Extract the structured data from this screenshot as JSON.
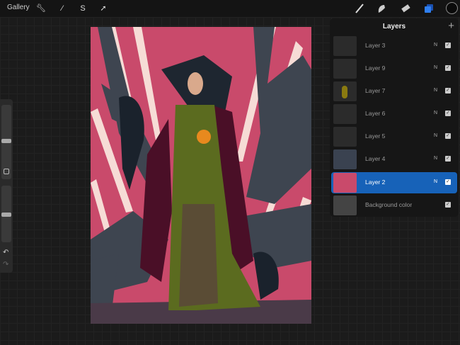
{
  "topbar": {
    "gallery": "Gallery",
    "left_icons": [
      "wrench-icon",
      "magic-wand-icon",
      "selection-icon",
      "move-arrow-icon"
    ],
    "right_icons": [
      "brush-icon",
      "smudge-icon",
      "eraser-icon",
      "layers-icon",
      "color-picker-icon"
    ],
    "accent": "#1f6fe0"
  },
  "layers": {
    "title": "Layers",
    "add": "+",
    "items": [
      {
        "name": "Layer 3",
        "mode": "N",
        "visible": true,
        "selected": false
      },
      {
        "name": "Layer 9",
        "mode": "N",
        "visible": true,
        "selected": false
      },
      {
        "name": "Layer 7",
        "mode": "N",
        "visible": true,
        "selected": false
      },
      {
        "name": "Layer 6",
        "mode": "N",
        "visible": true,
        "selected": false
      },
      {
        "name": "Layer 5",
        "mode": "N",
        "visible": true,
        "selected": false
      },
      {
        "name": "Layer 4",
        "mode": "N",
        "visible": true,
        "selected": false
      },
      {
        "name": "Layer 2",
        "mode": "N",
        "visible": true,
        "selected": true
      }
    ],
    "background": {
      "name": "Background color",
      "visible": true
    }
  },
  "colors": {
    "selected_row": "#1762b8",
    "pink": "#c94a6b",
    "tree": "#3e4550",
    "dress": "#5b6b1f",
    "cloak": "#4a0f27"
  }
}
